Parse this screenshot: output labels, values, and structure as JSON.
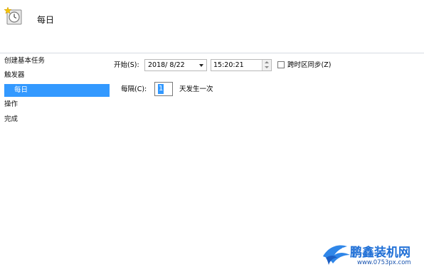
{
  "header": {
    "title": "每日",
    "icon": "task-clock-icon"
  },
  "sidebar": {
    "items": [
      {
        "label": "创建基本任务"
      },
      {
        "label": "触发器"
      },
      {
        "label": "每日",
        "selected": true
      },
      {
        "label": "操作"
      },
      {
        "label": "完成"
      }
    ]
  },
  "form": {
    "start_label": "开始(S):",
    "start_date": "2018/ 8/22",
    "start_time": "15:20:21",
    "sync_timezone_label": "跨时区同步(Z)",
    "sync_timezone_checked": false,
    "recur_label": "每隔(C):",
    "recur_value": "1",
    "recur_suffix": "天发生一次"
  },
  "watermark": {
    "title": "鹏鑫装机网",
    "url": "www.0753px.com"
  },
  "colors": {
    "selection": "#3399ff",
    "watermark": "#1f6fd6"
  }
}
